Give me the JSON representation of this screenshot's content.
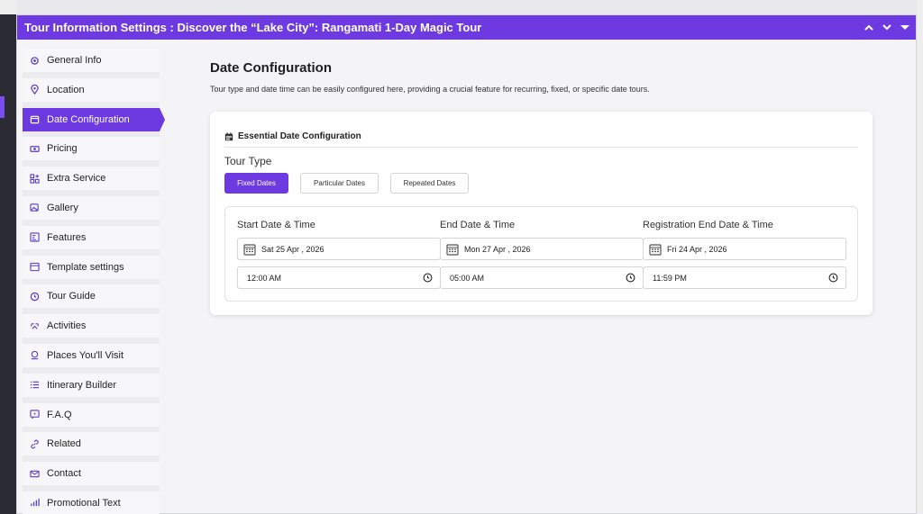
{
  "window": {
    "title": "Tour Information Settings : Discover the “Lake City”: Rangamati 1-Day Magic Tour",
    "controls": [
      "chevron-up-icon",
      "chevron-down-icon",
      "caret-down-icon"
    ]
  },
  "sidebar": {
    "items": [
      {
        "label": "General Info",
        "icon": "gear-icon"
      },
      {
        "label": "Location",
        "icon": "map-pin-icon"
      },
      {
        "label": "Date Configuration",
        "icon": "calendar-icon",
        "active": true
      },
      {
        "label": "Pricing",
        "icon": "money-icon"
      },
      {
        "label": "Extra Service",
        "icon": "grid-plus-icon"
      },
      {
        "label": "Gallery",
        "icon": "gallery-icon"
      },
      {
        "label": "Features",
        "icon": "features-icon"
      },
      {
        "label": "Template settings",
        "icon": "template-icon"
      },
      {
        "label": "Tour Guide",
        "icon": "guide-icon"
      },
      {
        "label": "Activities",
        "icon": "activities-icon"
      },
      {
        "label": "Places You'll Visit",
        "icon": "places-icon"
      },
      {
        "label": "Itinerary Builder",
        "icon": "list-icon"
      },
      {
        "label": "F.A.Q",
        "icon": "faq-icon"
      },
      {
        "label": "Related",
        "icon": "link-icon"
      },
      {
        "label": "Contact",
        "icon": "mail-icon"
      },
      {
        "label": "Promotional Text",
        "icon": "promo-icon"
      }
    ]
  },
  "main": {
    "title": "Date Configuration",
    "description": "Tour type and date time can be easily configured here, providing a crucial feature for recurring, fixed, or specific date tours.",
    "card": {
      "heading": "Essential Date Configuration",
      "tour_type_label": "Tour Type",
      "tour_types": [
        {
          "label": "Fixed Dates",
          "active": true
        },
        {
          "label": "Particular Dates",
          "active": false
        },
        {
          "label": "Repeated Dates",
          "active": false
        }
      ],
      "columns": [
        {
          "label": "Start Date & Time",
          "date": "Sat 25 Apr , 2026",
          "time": "12:00 AM"
        },
        {
          "label": "End Date & Time",
          "date": "Mon 27 Apr , 2026",
          "time": "05:00 AM"
        },
        {
          "label": "Registration End Date & Time",
          "date": "Fri 24 Apr , 2026",
          "time": "11:59 PM"
        }
      ]
    }
  },
  "colors": {
    "accent": "#6c3ae0",
    "page_bg": "#f4f4f6",
    "card_bg": "#ffffff"
  }
}
